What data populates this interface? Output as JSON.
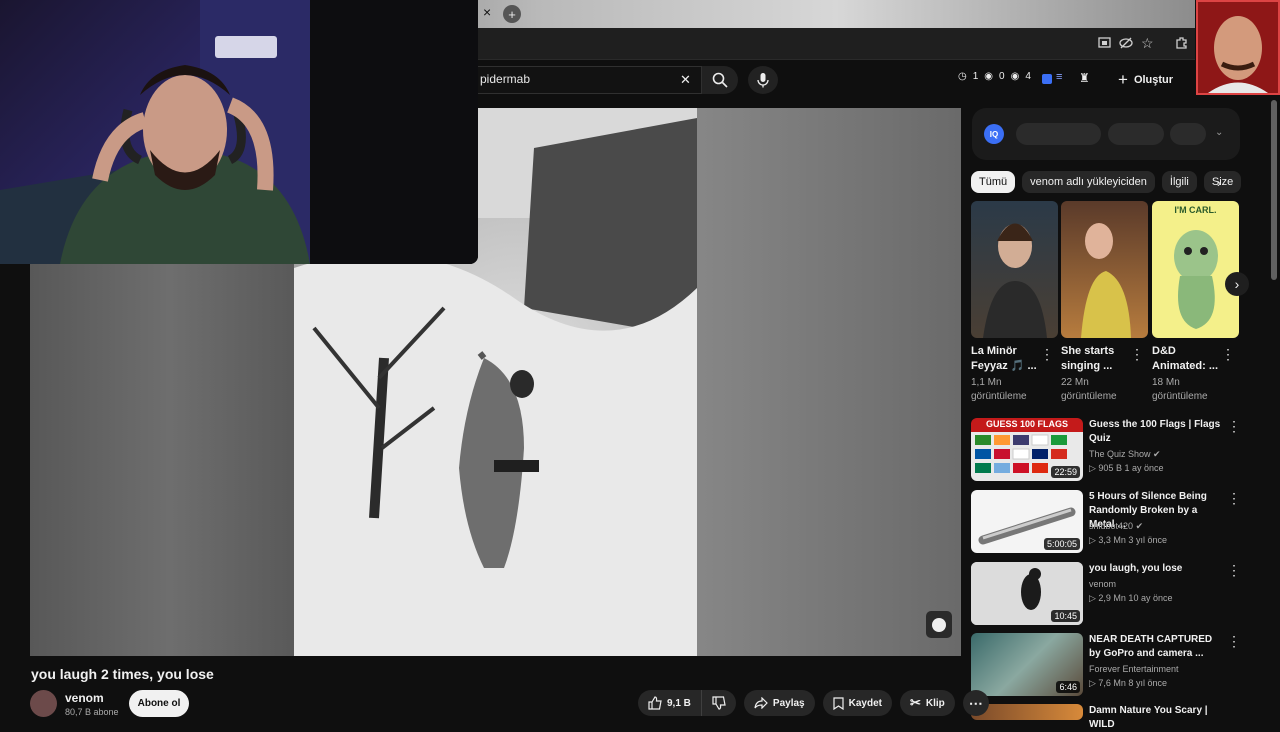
{
  "browser": {
    "close_tab_glyph": "×",
    "new_tab_glyph": "+"
  },
  "search": {
    "query": "pidermab",
    "clear_glyph": "✕"
  },
  "header": {
    "stats": [
      {
        "icon": "clock-icon",
        "value": "1"
      },
      {
        "icon": "eye-icon",
        "value": "0"
      },
      {
        "icon": "eye-icon",
        "value": "4"
      }
    ],
    "create_label": "Oluştur"
  },
  "filters": {
    "chips": [
      "Tümü",
      "venom adlı yükleyiciden",
      "İlgili",
      "Size"
    ]
  },
  "shorts": [
    {
      "title_line1": "La Minör",
      "title_line2": "Feyyaz 🎵 ...",
      "views_line1": "1,1 Mn",
      "views_line2": "görüntüleme"
    },
    {
      "title_line1": "She starts",
      "title_line2": "singing ...",
      "views_line1": "22 Mn",
      "views_line2": "görüntüleme"
    },
    {
      "title_line1": "D&D",
      "title_line2": "Animated: ...",
      "views_line1": "18 Mn",
      "views_line2": "görüntüleme",
      "thumb_text": "I'M CARL."
    }
  ],
  "recommendations": [
    {
      "title": "Guess the 100 Flags | Flags Quiz",
      "channel": "The Quiz Show",
      "verified": true,
      "meta": "▷ 905 B   1 ay önce",
      "duration": "22:59",
      "thumb_banner": "GUESS 100 FLAGS"
    },
    {
      "title": "5 Hours of Silence Being Randomly Broken by a Metal ...",
      "channel": "shidbot420",
      "verified": true,
      "meta": "▷ 3,3 Mn   3 yıl önce",
      "duration": "5:00:05"
    },
    {
      "title": "you laugh, you lose",
      "channel": "venom",
      "verified": false,
      "meta": "▷ 2,9 Mn   10 ay önce",
      "duration": "10:45"
    },
    {
      "title": "NEAR DEATH CAPTURED by GoPro and camera ...",
      "channel": "Forever Entertainment",
      "verified": false,
      "meta": "▷ 7,6 Mn   8 yıl önce",
      "duration": "6:46"
    },
    {
      "title": "Damn Nature You Scary | WILD",
      "channel": "",
      "verified": false,
      "meta": "",
      "duration": ""
    }
  ],
  "video": {
    "title": "you laugh 2 times, you lose",
    "channel": "venom",
    "subscribers": "80,7 B abone",
    "subscribe_label": "Abone ol",
    "likes": "9,1 B",
    "share_label": "Paylaş",
    "save_label": "Kaydet",
    "clip_label": "Klip"
  },
  "colors": {
    "background": "#0f0f0f",
    "text": "#f1f1f1",
    "muted": "#aaaaaa",
    "chip": "#272727",
    "ext_accent": "#3b6ff5"
  }
}
